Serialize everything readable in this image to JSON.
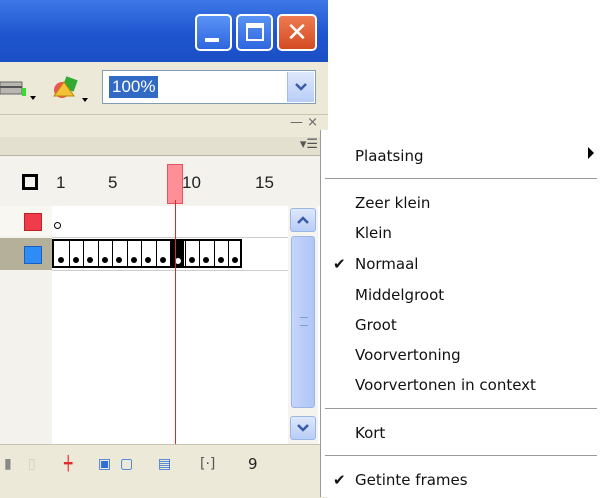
{
  "titlebar": {
    "buttons": [
      "minimize",
      "maximize",
      "close"
    ]
  },
  "toolbar": {
    "zoom_value": "100%"
  },
  "timeline": {
    "ruler_labels": [
      "1",
      "5",
      "10",
      "15"
    ],
    "current_frame": "9",
    "layers": [
      {
        "color": "#ef3b4b"
      },
      {
        "color": "#2f8cf4"
      }
    ]
  },
  "context_menu": {
    "items": [
      {
        "label": "Plaatsing",
        "has_submenu": true,
        "checked": false
      },
      {
        "label": "Zeer klein",
        "checked": false
      },
      {
        "label": "Klein",
        "checked": false
      },
      {
        "label": "Normaal",
        "checked": true
      },
      {
        "label": "Middelgroot",
        "checked": false
      },
      {
        "label": "Groot",
        "checked": false
      },
      {
        "label": "Voorvertoning",
        "checked": false
      },
      {
        "label": "Voorvertonen in context",
        "checked": false
      },
      {
        "label": "Kort",
        "checked": false
      },
      {
        "label": "Getinte frames",
        "checked": true
      }
    ]
  },
  "colors": {
    "titlebar_blue": "#1f56d0",
    "close_red": "#d44b21",
    "playhead": "#ff8f96",
    "layer_red": "#ef3b4b",
    "layer_blue": "#2f8cf4"
  }
}
